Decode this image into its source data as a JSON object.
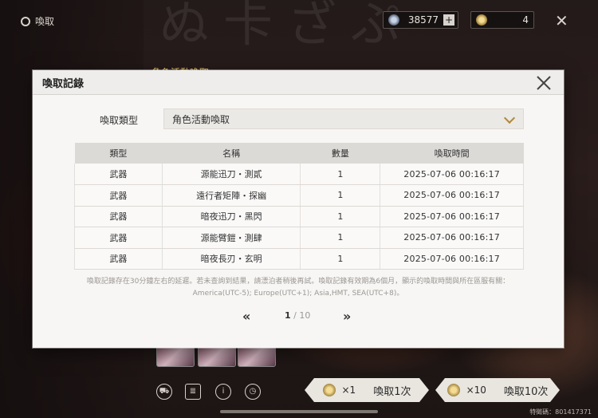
{
  "app": {
    "top_left_label": "喚取",
    "currency_1": "38577",
    "currency_2": "4",
    "banner_label": "角色活動喚取",
    "title_art": "ぬ卡ざぷ",
    "pull_1": {
      "count": "×1",
      "label": "喚取1次"
    },
    "pull_10": {
      "count": "×10",
      "label": "喚取10次"
    },
    "uid": "特徵碼：801417371"
  },
  "dialog": {
    "title": "喚取記錄",
    "type_label": "喚取類型",
    "type_value": "角色活動喚取",
    "columns": {
      "type": "類型",
      "name": "名稱",
      "qty": "數量",
      "time": "喚取時間"
    },
    "rows": [
      {
        "type": "武器",
        "name": "源能迅刀・測貳",
        "qty": "1",
        "time": "2025-07-06 00:16:17"
      },
      {
        "type": "武器",
        "name": "遠行者矩陣・探幽",
        "qty": "1",
        "time": "2025-07-06 00:16:17"
      },
      {
        "type": "武器",
        "name": "暗夜迅刀・黑閃",
        "qty": "1",
        "time": "2025-07-06 00:16:17"
      },
      {
        "type": "武器",
        "name": "源能臂鎧・測肆",
        "qty": "1",
        "time": "2025-07-06 00:16:17"
      },
      {
        "type": "武器",
        "name": "暗夜長刃・玄明",
        "qty": "1",
        "time": "2025-07-06 00:16:17"
      }
    ],
    "note_line_1": "喚取記錄存在30分鐘左右的延遲。若未查詢到結果，請漂泊者稍後再試。喚取記錄有效期為6個月，顯示的喚取時間與所在區服有關：",
    "note_line_2": "America(UTC-5); Europe(UTC+1); Asia,HMT, SEA(UTC+8)。",
    "page_current": "1",
    "page_total": " / 10",
    "prev_label": "«",
    "next_label": "»"
  },
  "icons": [
    "gear-icon",
    "star-currency-icon",
    "coin-icon",
    "plus-icon",
    "close-icon",
    "chevron-down-icon",
    "shop-icon",
    "list-icon",
    "info-icon",
    "history-icon"
  ]
}
